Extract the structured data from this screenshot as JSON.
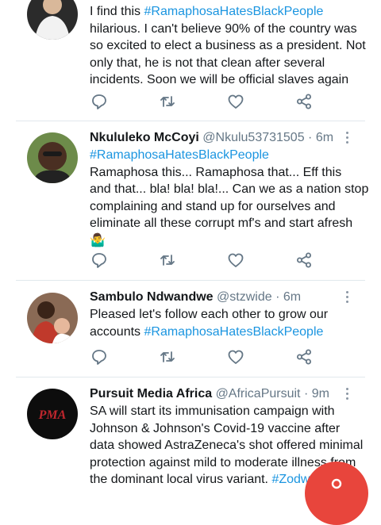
{
  "tweets": [
    {
      "name": "",
      "handle": "",
      "time": "",
      "lines": [
        [
          {
            "t": "I find this "
          },
          {
            "t": "#RamaphosaHatesBlackPeople",
            "tag": true
          }
        ],
        [
          {
            "t": "hilarious. I can't believe 90% of the country was"
          }
        ],
        [
          {
            "t": "so excited to elect a business as a president. Not"
          }
        ],
        [
          {
            "t": "only that, he is not that clean after several"
          }
        ],
        [
          {
            "t": "incidents. Soon we will be official slaves again"
          }
        ]
      ]
    },
    {
      "name": "Nkululeko McCoyi",
      "handle": "@Nkulu53731505 · 6m",
      "lines": [
        [
          {
            "t": "#RamaphosaHatesBlackPeople",
            "tag": true
          }
        ],
        [
          {
            "t": "Ramaphosa this... Ramaphosa that... Eff this"
          }
        ],
        [
          {
            "t": "and that... bla! bla! bla!... Can we as a nation stop"
          }
        ],
        [
          {
            "t": "complaining and stand up for ourselves and"
          }
        ],
        [
          {
            "t": "eliminate all these corrupt mf's and start afresh"
          }
        ],
        [
          {
            "t": "🤷‍♂️"
          }
        ]
      ]
    },
    {
      "name": "Sambulo Ndwandwe",
      "handle": "@stzwide · 6m",
      "lines": [
        [
          {
            "t": "Pleased let's follow each other to grow our"
          }
        ],
        [
          {
            "t": "accounts "
          },
          {
            "t": "#RamaphosaHatesBlackPeople",
            "tag": true
          }
        ]
      ]
    },
    {
      "name": "Pursuit Media Africa",
      "handle": "@AfricaPursuit · 9m",
      "avatar_text": "PMA",
      "lines": [
        [
          {
            "t": "SA will start its immunisation campaign with"
          }
        ],
        [
          {
            "t": "Johnson & Johnson's Covid-19 vaccine after"
          }
        ],
        [
          {
            "t": "data showed AstraZeneca's shot offered minimal"
          }
        ],
        [
          {
            "t": "protection against mild to moderate illness from"
          }
        ],
        [
          {
            "t": "the dominant local virus variant. "
          },
          {
            "t": "#Zodwa",
            "tag": true
          }
        ]
      ]
    }
  ],
  "icons": {
    "reply": "reply-icon",
    "retweet": "retweet-icon",
    "like": "heart-icon",
    "share": "share-icon",
    "more": "more-options-icon",
    "fab": "compose-fab-icon"
  },
  "colors": {
    "hashtag": "#1b95e0",
    "handle": "#657786",
    "icon": "#657786",
    "divider": "#e1e8ed",
    "fab": "#e8453c"
  }
}
